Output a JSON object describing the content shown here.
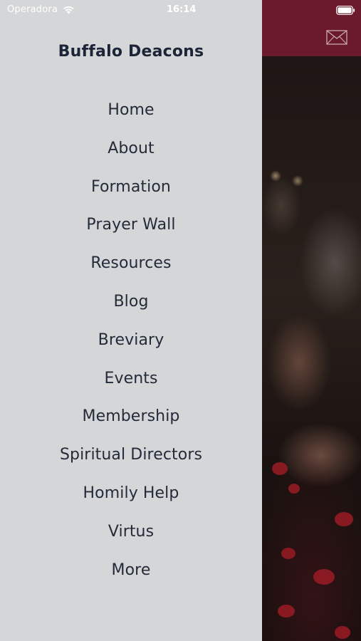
{
  "status_bar": {
    "carrier": "Operadora",
    "time": "16:14"
  },
  "drawer": {
    "title": "Buffalo Deacons",
    "items": [
      {
        "label": "Home"
      },
      {
        "label": "About"
      },
      {
        "label": "Formation"
      },
      {
        "label": "Prayer Wall"
      },
      {
        "label": "Resources"
      },
      {
        "label": "Blog"
      },
      {
        "label": "Breviary"
      },
      {
        "label": "Events"
      },
      {
        "label": "Membership"
      },
      {
        "label": "Spiritual Directors"
      },
      {
        "label": "Homily Help"
      },
      {
        "label": "Virtus"
      },
      {
        "label": "More"
      }
    ]
  },
  "header": {
    "mail_icon": "mail-icon",
    "background_color": "#6a1a2b"
  },
  "colors": {
    "drawer_background": "#d5d6d7",
    "menu_text": "#232b3a",
    "title_text": "#1c2538",
    "header_accent": "#6a1a2b"
  }
}
